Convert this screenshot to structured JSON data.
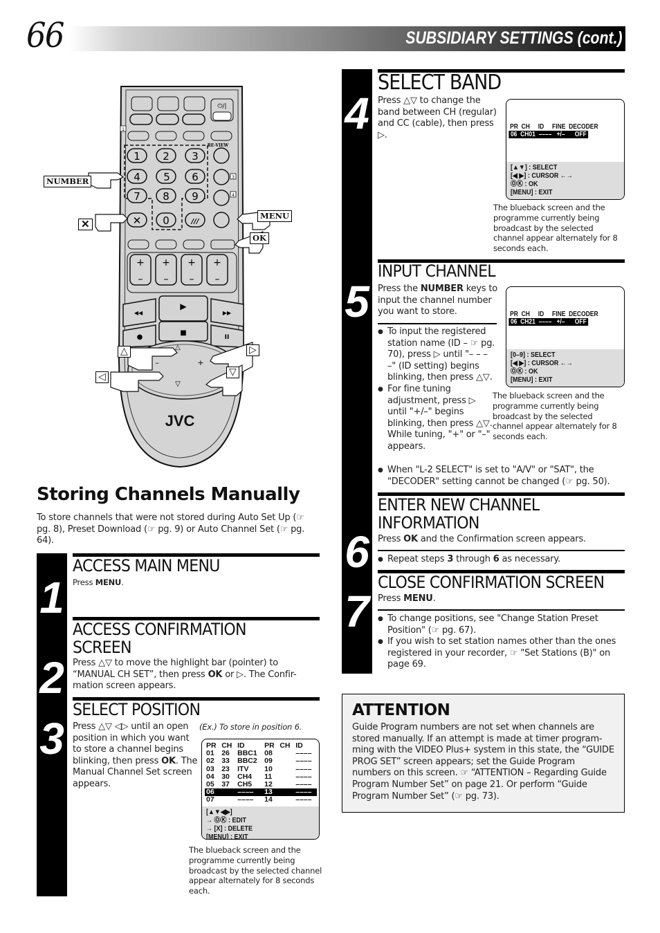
{
  "header": {
    "page_number": "66",
    "title": "SUBSIDIARY SETTINGS (cont.)"
  },
  "remote": {
    "brand": "JVC",
    "number_keys": [
      "1",
      "2",
      "3",
      "4",
      "5",
      "6",
      "7",
      "8",
      "9",
      "0"
    ],
    "review_label": "RE-VIEW",
    "callouts": {
      "number": "NUMBER",
      "menu": "MENU",
      "ok": "OK",
      "x": "✕",
      "up": "△",
      "down": "▽",
      "left": "◁",
      "right": "▷"
    },
    "small_box_labels": [
      "1",
      "2",
      "3",
      "4"
    ],
    "colors": {
      "body": "#d4d4d4",
      "outline": "#111111"
    }
  },
  "intro": {
    "title": "Storing Channels Manually",
    "text": "To store channels that were not stored during Auto Set Up (☞ pg. 8), Preset Download (☞ pg. 9) or Auto Channel Set (☞ pg. 64)."
  },
  "steps": [
    {
      "number": "1",
      "heading": "ACCESS MAIN MENU",
      "text_pre": "Press ",
      "text_bold": "MENU",
      "text_post": "."
    },
    {
      "number": "2",
      "heading_line1": "ACCESS CONFIRMATION",
      "heading_line2": "SCREEN",
      "text_pre": "Press △▽ to move the highlight bar (pointer) to “MANUAL CH SET”, then press ",
      "text_bold": "OK",
      "text_post": " or ▷. The Confir-mation screen appears."
    },
    {
      "number": "3",
      "heading": "SELECT POSITION",
      "text_pre": "Press △▽ ◁▷ until an open position in which you want to store a channel begins blinking, then press ",
      "text_bold": "OK",
      "text_post": ". The Manual Channel Set screen appears.",
      "example_caption": "(Ex.) To store in position 6.",
      "table": {
        "headers": [
          "PR",
          "CH",
          "ID",
          "PR",
          "CH",
          "ID"
        ],
        "rows": [
          [
            "01",
            "26",
            "BBC1",
            "08",
            "",
            "––––"
          ],
          [
            "02",
            "33",
            "BBC2",
            "09",
            "",
            "––––"
          ],
          [
            "03",
            "23",
            "ITV",
            "10",
            "",
            "––––"
          ],
          [
            "04",
            "30",
            "CH4",
            "11",
            "",
            "––––"
          ],
          [
            "05",
            "37",
            "CH5",
            "12",
            "",
            "––––"
          ],
          [
            "06",
            "",
            "––––",
            "13",
            "",
            "––––"
          ],
          [
            "07",
            "",
            "––––",
            "14",
            "",
            "––––"
          ]
        ],
        "selected_row": 5,
        "footer": [
          "[▲▼◀▶]",
          "→ ⓄⓀ : EDIT",
          "→ [X] : DELETE",
          "[MENU] : EXIT"
        ]
      },
      "note": "The blueback screen and the programme currently being broadcast by the selected channel appear alternately for 8 seconds each."
    },
    {
      "number": "4",
      "heading": "SELECT BAND",
      "text": "Press △▽ to change the band between CH (regular) and CC (cable), then press ▷.",
      "osd": {
        "header": "PR  CH     ID     FINE  DECODER",
        "values": "06  CH01  ––––   +/–      OFF",
        "footer": [
          "[▲▼] : SELECT",
          "[◀ ▶] : CURSOR ←→",
          "ⓄⓀ : OK",
          "[MENU] : EXIT"
        ]
      },
      "note": "The blueback screen and the programme currently being broadcast by the selected channel appear alternately for 8 seconds each."
    },
    {
      "number": "5",
      "heading": "INPUT CHANNEL",
      "text_pre": "Press the ",
      "text_bold": "NUMBER",
      "text_post": " keys to input the channel number you want to store.",
      "bullets": [
        "To input the registered station name (ID – ☞ pg. 70), press ▷ until \"– – – –\" (ID setting) begins blinking, then press △▽.",
        "For fine tuning adjustment, press ▷ until \"+/–\" begins blinking, then press △▽. While tuning, \"+\" or \"–\" appears.",
        "When \"L-2 SELECT\" is set to \"A/V\" or \"SAT\", the \"DECODER\" setting cannot be changed (☞ pg. 50)."
      ],
      "osd": {
        "header": "PR  CH     ID     FINE  DECODER",
        "values": "06  CH21  ––––   +/–      OFF",
        "footer": [
          "[0–9] : SELECT",
          "[◀ ▶] : CURSOR ←→",
          "ⓄⓀ : OK",
          "[MENU] : EXIT"
        ]
      },
      "note": "The blueback screen and the programme currently being broadcast by the selected channel appear alternately for 8 seconds each."
    },
    {
      "number": "6",
      "heading_line1": "ENTER NEW CHANNEL",
      "heading_line2": "INFORMATION",
      "text_pre": "Press ",
      "text_bold": "OK",
      "text_post": " and the Confirmation screen appears.",
      "bullet_pre": "Repeat steps ",
      "bullet_b1": "3",
      "bullet_mid": " through ",
      "bullet_b2": "6",
      "bullet_post": " as necessary."
    },
    {
      "number": "7",
      "heading": "CLOSE CONFIRMATION SCREEN",
      "text_pre": "Press ",
      "text_bold": "MENU",
      "text_post": ".",
      "bullets": [
        "To change positions, see \"Change Station Preset Position\" (☞ pg. 67).",
        "If you wish to set station names other than the ones registered in your recorder, ☞ \"Set Stations (B)\" on page 69."
      ]
    }
  ],
  "attention": {
    "title": "ATTENTION",
    "text": "Guide Program numbers are not set when channels are stored manually. If an attempt is made at timer program-ming with the VIDEO Plus+ system in this state, the “GUIDE PROG SET” screen appears; set the Guide Program numbers on this screen. ☞ “ATTENTION – Regarding Guide Program Number Set” on page 21. Or perform “Guide Program Number Set” (☞ pg. 73)."
  }
}
